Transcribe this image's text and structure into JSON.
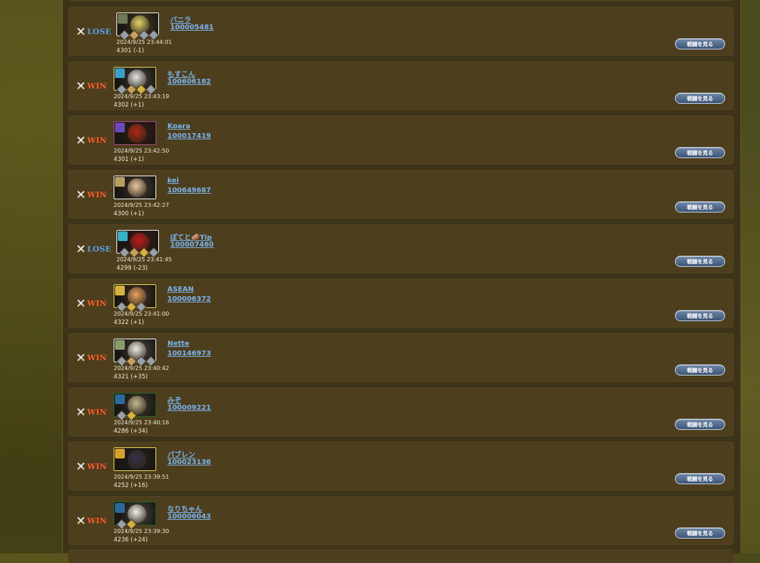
{
  "button_label": "戦闘を見る",
  "rows": [
    {
      "result": "LOSE",
      "name": "バニラ",
      "player_id": "100005481",
      "time": "2024/9/25 23:44:01",
      "rating": "4301 (-1)",
      "face_color": "#e2d26a",
      "badge_color": "#6f7a55",
      "frame": "#ffffff",
      "gems": [
        "#9aa0a8",
        "#c8a060",
        "#9aa0a8",
        "#9aa0a8"
      ]
    },
    {
      "result": "WIN",
      "name": "もすこん",
      "player_id": "100606182",
      "time": "2024/9/25 23:43:19",
      "rating": "4302 (+1)",
      "face_color": "#e6e6e6",
      "badge_color": "#3aa0c8",
      "frame": "#f0e060",
      "gems": [
        "#9aa0a8",
        "#c8a060",
        "#d8b040",
        "#9aa0a8"
      ]
    },
    {
      "result": "WIN",
      "name": "Koara",
      "player_id": "100017419",
      "time": "2024/9/25 23:42:50",
      "rating": "4301 (+1)",
      "face_color": "#b02818",
      "badge_color": "#6a4ab8",
      "frame": "#b04a8a",
      "gems": []
    },
    {
      "result": "WIN",
      "name": "kei",
      "player_id": "100649687",
      "time": "2024/9/25 23:42:27",
      "rating": "4300 (+1)",
      "face_color": "#e8c8a0",
      "badge_color": "#b8a060",
      "frame": "#ffffff",
      "gems": []
    },
    {
      "result": "LOSE",
      "name": "ぽてと🥔Tip",
      "player_id": "100007460",
      "time": "2024/9/25 23:41:45",
      "rating": "4299 (-23)",
      "face_color": "#c01818",
      "badge_color": "#3ab0c8",
      "frame": "#ffffff",
      "gems": [
        "#9aa0a8",
        "#c8a060",
        "#d8b040",
        "#9aa0a8"
      ]
    },
    {
      "result": "WIN",
      "name": "ASEAN",
      "player_id": "100006372",
      "time": "2024/9/25 23:41:00",
      "rating": "4322 (+1)",
      "face_color": "#e8a060",
      "badge_color": "#d8b040",
      "frame": "#f0e060",
      "gems": [
        "#9aa0a8",
        "#d8b040",
        "#9aa0a8"
      ]
    },
    {
      "result": "WIN",
      "name": "Nette",
      "player_id": "100146973",
      "time": "2024/9/25 23:40:42",
      "rating": "4321 (+35)",
      "face_color": "#f0ece6",
      "badge_color": "#8a9a6a",
      "frame": "#ffffff",
      "gems": [
        "#9aa0a8",
        "#c8a060",
        "#9aa0a8",
        "#9aa0a8"
      ]
    },
    {
      "result": "WIN",
      "name": "みぞ",
      "player_id": "100009221",
      "time": "2024/9/25 23:40:16",
      "rating": "4286 (+34)",
      "face_color": "#c0b890",
      "badge_color": "#2a6a9a",
      "frame": "#1a6a2a",
      "gems": [
        "#9aa0a8",
        "#d8b040"
      ]
    },
    {
      "result": "WIN",
      "name": "パブレン",
      "player_id": "100023136",
      "time": "2024/9/25 23:39:51",
      "rating": "4252 (+16)",
      "face_color": "#3a3048",
      "badge_color": "#d8a030",
      "frame": "#f0e060",
      "gems": []
    },
    {
      "result": "WIN",
      "name": "なりちゃん",
      "player_id": "100006043",
      "time": "2024/9/25 23:39:30",
      "rating": "4236 (+24)",
      "face_color": "#f4f0ea",
      "badge_color": "#2a6a9a",
      "frame": "#1a6a2a",
      "gems": [
        "#9aa0a8",
        "#d8b040"
      ]
    }
  ]
}
